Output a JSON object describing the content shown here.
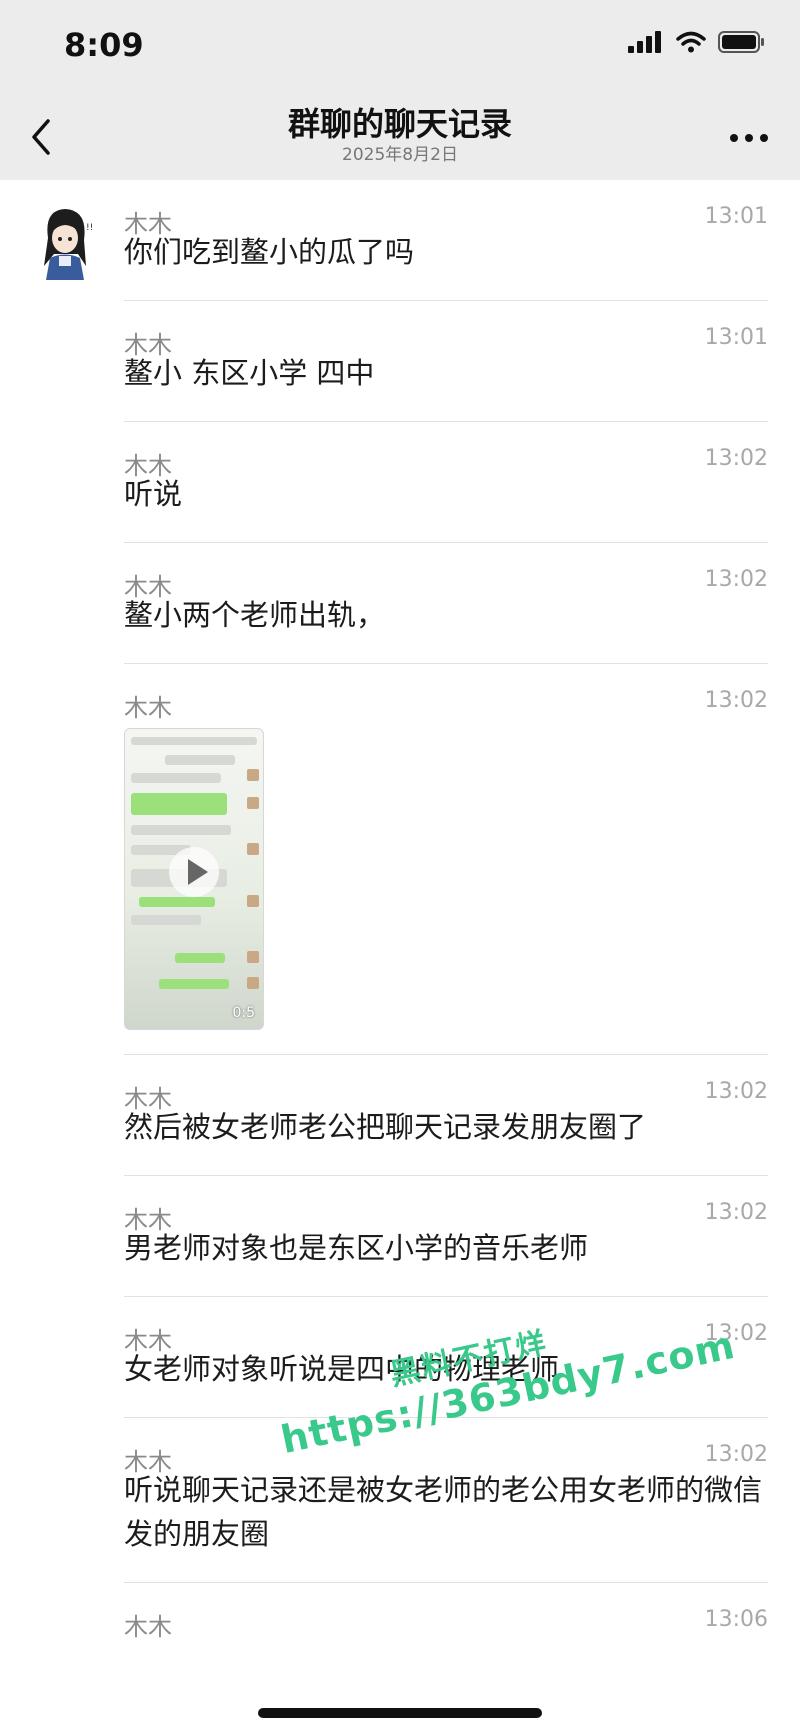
{
  "status_bar": {
    "time": "8:09"
  },
  "nav": {
    "title": "群聊的聊天记录",
    "subtitle": "2025年8月2日"
  },
  "messages": [
    {
      "sender": "木木",
      "time": "13:01",
      "text": "你们吃到鳌小的瓜了吗"
    },
    {
      "sender": "木木",
      "time": "13:01",
      "text": "鳌小 东区小学 四中"
    },
    {
      "sender": "木木",
      "time": "13:02",
      "text": "听说"
    },
    {
      "sender": "木木",
      "time": "13:02",
      "text": "鳌小两个老师出轨，"
    },
    {
      "sender": "木木",
      "time": "13:02",
      "video_duration": "0:5"
    },
    {
      "sender": "木木",
      "time": "13:02",
      "text": "然后被女老师老公把聊天记录发朋友圈了"
    },
    {
      "sender": "木木",
      "time": "13:02",
      "text": "男老师对象也是东区小学的音乐老师"
    },
    {
      "sender": "木木",
      "time": "13:02",
      "text": "女老师对象听说是四中的物理老师"
    },
    {
      "sender": "木木",
      "time": "13:02",
      "text": "听说聊天记录还是被女老师的老公用女老师的微信发的朋友圈"
    },
    {
      "sender": "木木",
      "time": "13:06"
    }
  ],
  "watermark": {
    "line1": "黑料不打烊",
    "line2": "https://363bdy7.com"
  },
  "icons": {
    "back": "chevron-left-icon",
    "more": "more-dots-icon",
    "play": "play-icon"
  }
}
